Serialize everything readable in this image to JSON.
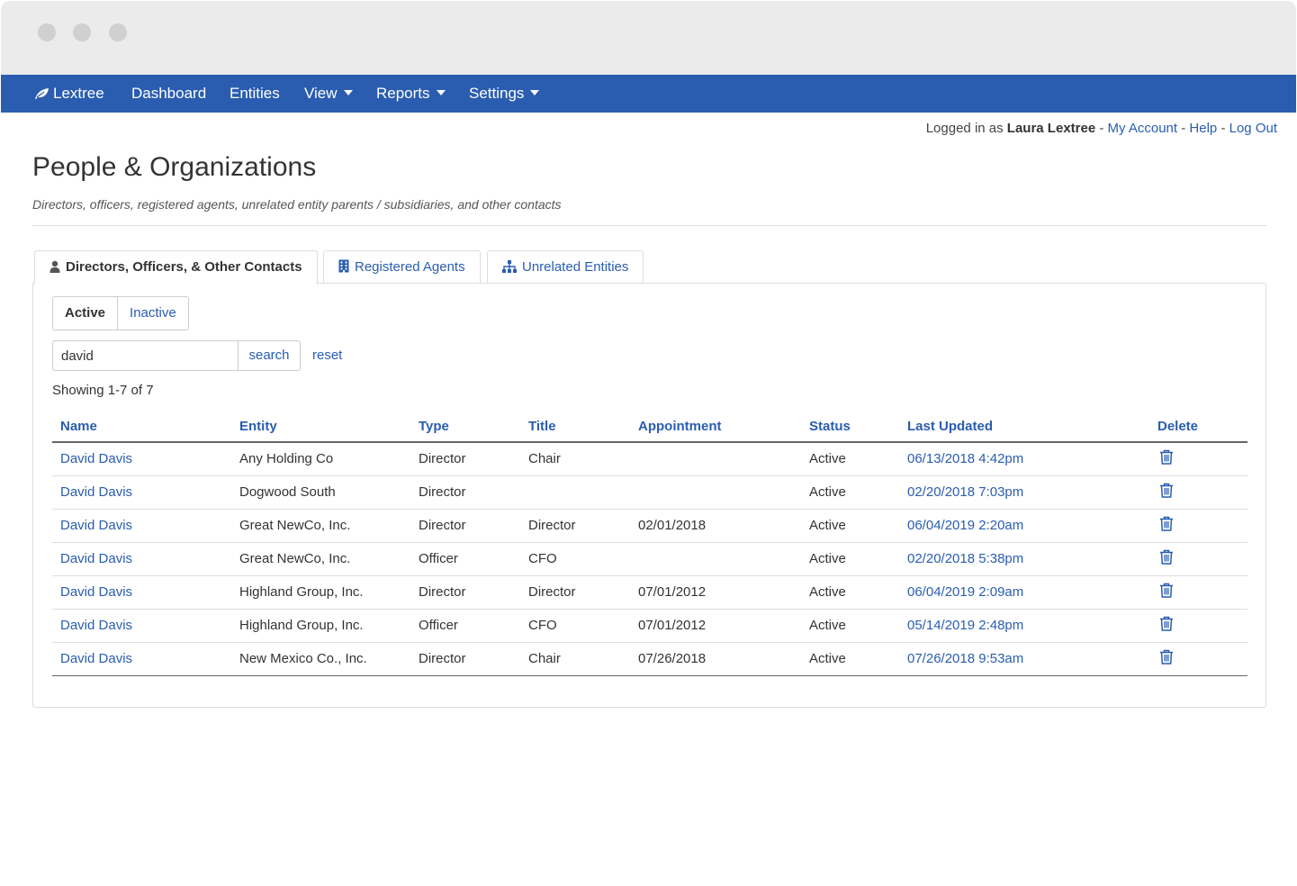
{
  "window": {
    "controls": [
      "close",
      "minimize",
      "zoom"
    ]
  },
  "navbar": {
    "brand": "Lextree",
    "brand_icon": "leaf-icon",
    "items": [
      {
        "label": "Dashboard"
      },
      {
        "label": "Entities"
      },
      {
        "label": "View",
        "dropdown": true
      },
      {
        "label": "Reports",
        "dropdown": true
      },
      {
        "label": "Settings",
        "dropdown": true
      }
    ],
    "color": "#2a5db0"
  },
  "userbar": {
    "prefix": "Logged in as",
    "user_name": "Laura Lextree",
    "sep": "-",
    "my_account": "My Account",
    "help": "Help",
    "log_out": "Log Out"
  },
  "page": {
    "title": "People & Organizations",
    "subtitle": "Directors, officers, registered agents, unrelated entity parents / subsidiaries, and other contacts"
  },
  "tabs": [
    {
      "label": "Directors, Officers, & Other Contacts",
      "icon": "person-icon",
      "active": true
    },
    {
      "label": "Registered Agents",
      "icon": "building-icon",
      "active": false
    },
    {
      "label": "Unrelated Entities",
      "icon": "org-chart-icon",
      "active": false
    }
  ],
  "filter": {
    "active_label": "Active",
    "inactive_label": "Inactive",
    "selected": "Active"
  },
  "search": {
    "value": "david",
    "button": "search",
    "reset": "reset"
  },
  "results": {
    "count_text": "Showing 1-7 of 7"
  },
  "table": {
    "headers": [
      "Name",
      "Entity",
      "Type",
      "Title",
      "Appointment",
      "Status",
      "Last Updated",
      "Delete"
    ],
    "rows": [
      {
        "name": "David Davis",
        "entity": "Any Holding Co",
        "type": "Director",
        "title": "Chair",
        "appointment": "",
        "status": "Active",
        "updated": "06/13/2018 4:42pm"
      },
      {
        "name": "David Davis",
        "entity": "Dogwood South",
        "type": "Director",
        "title": "",
        "appointment": "",
        "status": "Active",
        "updated": "02/20/2018 7:03pm"
      },
      {
        "name": "David Davis",
        "entity": "Great NewCo, Inc.",
        "type": "Director",
        "title": "Director",
        "appointment": "02/01/2018",
        "status": "Active",
        "updated": "06/04/2019 2:20am"
      },
      {
        "name": "David Davis",
        "entity": "Great NewCo, Inc.",
        "type": "Officer",
        "title": "CFO",
        "appointment": "",
        "status": "Active",
        "updated": "02/20/2018 5:38pm"
      },
      {
        "name": "David Davis",
        "entity": "Highland Group, Inc.",
        "type": "Director",
        "title": "Director",
        "appointment": "07/01/2012",
        "status": "Active",
        "updated": "06/04/2019 2:09am"
      },
      {
        "name": "David Davis",
        "entity": "Highland Group, Inc.",
        "type": "Officer",
        "title": "CFO",
        "appointment": "07/01/2012",
        "status": "Active",
        "updated": "05/14/2019 2:48pm"
      },
      {
        "name": "David Davis",
        "entity": "New Mexico Co., Inc.",
        "type": "Director",
        "title": "Chair",
        "appointment": "07/26/2018",
        "status": "Active",
        "updated": "07/26/2018 9:53am"
      }
    ],
    "delete_icon": "trash-icon"
  }
}
